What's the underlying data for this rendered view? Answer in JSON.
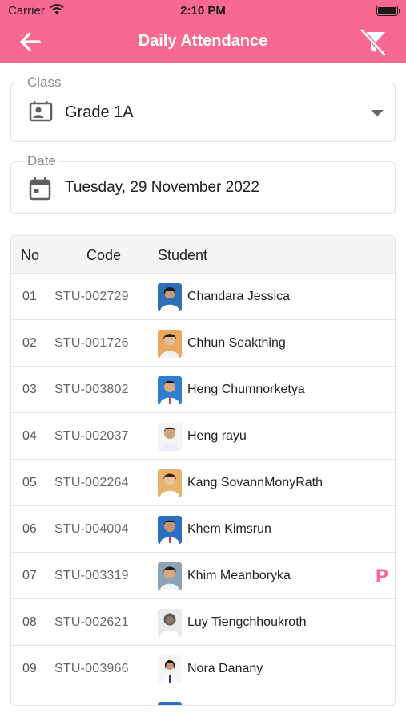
{
  "status_bar": {
    "carrier": "Carrier",
    "time": "2:10 PM"
  },
  "header": {
    "title": "Daily Attendance",
    "back_icon": "back-arrow-icon",
    "filter_icon": "filter-off-icon"
  },
  "class_field": {
    "label": "Class",
    "value": "Grade 1A",
    "icon": "contact-card-icon"
  },
  "date_field": {
    "label": "Date",
    "value": "Tuesday, 29 November 2022",
    "icon": "calendar-icon"
  },
  "table": {
    "headers": {
      "no": "No",
      "code": "Code",
      "student": "Student"
    },
    "rows": [
      {
        "no": "01",
        "code": "STU-002729",
        "name": "Chandara Jessica",
        "status": ""
      },
      {
        "no": "02",
        "code": "STU-001726",
        "name": "Chhun Seakthing",
        "status": ""
      },
      {
        "no": "03",
        "code": "STU-003802",
        "name": "Heng Chumnorketya",
        "status": ""
      },
      {
        "no": "04",
        "code": "STU-002037",
        "name": "Heng rayu",
        "status": ""
      },
      {
        "no": "05",
        "code": "STU-002264",
        "name": "Kang SovannMonyRath",
        "status": ""
      },
      {
        "no": "06",
        "code": "STU-004004",
        "name": "Khem Kimsrun",
        "status": ""
      },
      {
        "no": "07",
        "code": "STU-003319",
        "name": "Khim Meanboryka",
        "status": "P"
      },
      {
        "no": "08",
        "code": "STU-002621",
        "name": "Luy Tiengchhoukroth",
        "status": ""
      },
      {
        "no": "09",
        "code": "STU-003966",
        "name": "Nora Danany",
        "status": ""
      }
    ]
  },
  "colors": {
    "accent": "#f7698f",
    "header_text": "#ffffff",
    "border": "#e3e3e3"
  }
}
